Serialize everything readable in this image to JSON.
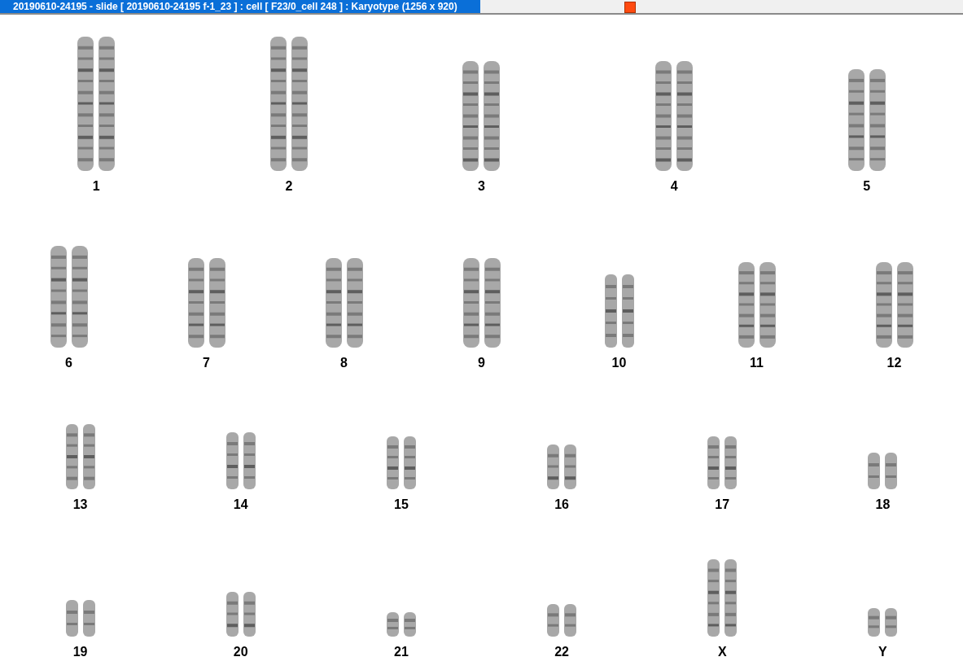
{
  "window": {
    "title": "20190610-24195 - slide [ 20190610-24195 f-1_23 ] : cell [ F23/0_cell 248 ] : Karyotype  (1256 x 920)"
  },
  "karyotype": {
    "rows": [
      {
        "items": [
          {
            "label": "1"
          },
          {
            "label": "2"
          },
          {
            "label": "3"
          },
          {
            "label": "4"
          },
          {
            "label": "5"
          }
        ]
      },
      {
        "items": [
          {
            "label": "6"
          },
          {
            "label": "7"
          },
          {
            "label": "8"
          },
          {
            "label": "9"
          },
          {
            "label": "10"
          },
          {
            "label": "11"
          },
          {
            "label": "12"
          }
        ]
      },
      {
        "items": [
          {
            "label": "13"
          },
          {
            "label": "14"
          },
          {
            "label": "15"
          },
          {
            "label": "16"
          },
          {
            "label": "17"
          },
          {
            "label": "18"
          }
        ]
      },
      {
        "items": [
          {
            "label": "19"
          },
          {
            "label": "20"
          },
          {
            "label": "21"
          },
          {
            "label": "22"
          },
          {
            "label": "X"
          },
          {
            "label": "Y"
          }
        ]
      }
    ]
  }
}
